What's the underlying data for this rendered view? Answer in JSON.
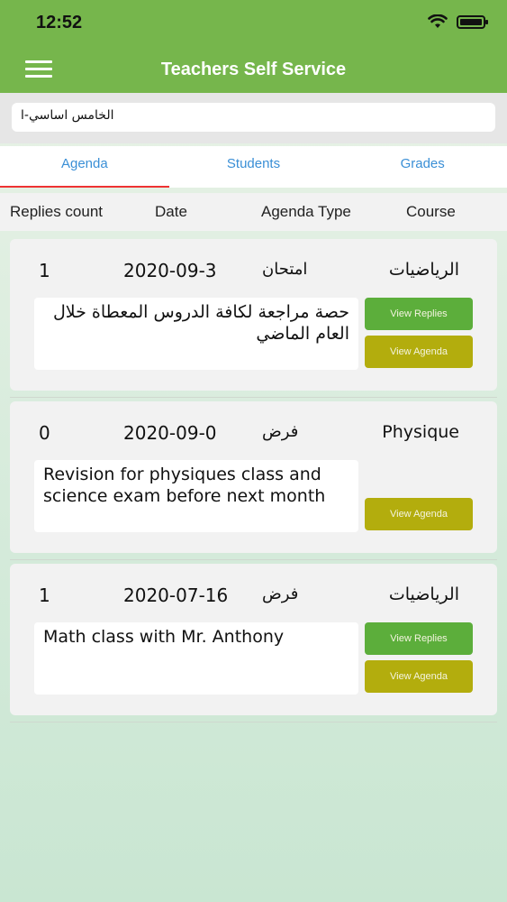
{
  "status": {
    "time": "12:52"
  },
  "header": {
    "title": "Teachers Self Service",
    "menu_icon": "hamburger-icon"
  },
  "class_selector": {
    "value": "الخامس اساسي-ا"
  },
  "tabs": [
    {
      "label": "Agenda",
      "active": true
    },
    {
      "label": "Students",
      "active": false
    },
    {
      "label": "Grades",
      "active": false
    }
  ],
  "columns": {
    "replies_count": "Replies count",
    "date": "Date",
    "agenda_type": "Agenda Type",
    "course": "Course"
  },
  "cards": [
    {
      "replies": "1",
      "date": "2020-09-3",
      "type": "امتحان",
      "course": "الرياضيات",
      "description": "حصة مراجعة لكافة الدروس المعطاة خلال العام الماضي",
      "view_replies": "View Replies",
      "view_agenda": "View Agenda"
    },
    {
      "replies": "0",
      "date": "2020-09-0",
      "type": "فرض",
      "course": "Physique",
      "description": "Revision for physiques class and science exam before next month",
      "view_agenda": "View Agenda"
    },
    {
      "replies": "1",
      "date": "2020-07-16",
      "type": "فرض",
      "course": "الرياضيات",
      "description": "Math class with Mr. Anthony",
      "view_replies": "View Replies",
      "view_agenda": "View Agenda"
    }
  ],
  "colors": {
    "header_green": "#76b64c",
    "tab_blue": "#3a8fd6",
    "tab_underline": "#e33333",
    "replies_button": "#5cae3b",
    "agenda_button": "#b3ad0d"
  }
}
